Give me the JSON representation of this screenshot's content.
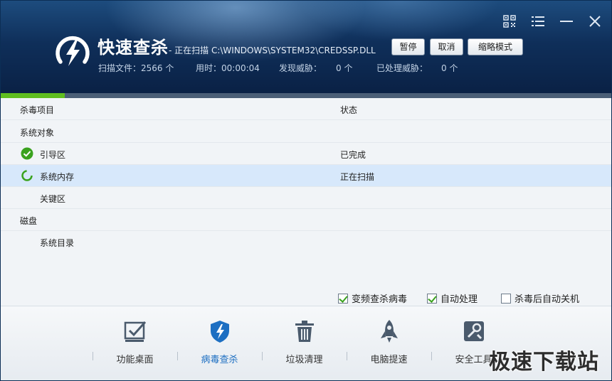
{
  "header": {
    "title": "快速查杀",
    "scan_path": "- 正在扫描 C:\\WINDOWS\\SYSTEM32\\CREDSSP.DLL",
    "stats": {
      "files": "扫描文件：2566 个",
      "time": "用时：00:00:04",
      "threats_label": "发现威胁：",
      "threats_value": "0 个",
      "handled_label": "已处理威胁：",
      "handled_value": "0 个"
    },
    "buttons": {
      "pause": "暂停",
      "cancel": "取消",
      "mini": "缩略模式"
    },
    "top_icons": [
      "qr-code-icon",
      "menu-icon",
      "minimize-icon",
      "close-icon"
    ]
  },
  "progress": {
    "fraction": 0.105,
    "color": "#5fbe1f"
  },
  "table": {
    "headers": {
      "item": "杀毒项目",
      "status": "状态"
    },
    "rows": [
      {
        "label": "系统对象",
        "status": "",
        "level": 0,
        "icon": ""
      },
      {
        "label": "引导区",
        "status": "已完成",
        "level": 1,
        "icon": "check-icon"
      },
      {
        "label": "系统内存",
        "status": "正在扫描",
        "level": 1,
        "icon": "spinner-icon"
      },
      {
        "label": "关键区",
        "status": "",
        "level": 1,
        "icon": ""
      },
      {
        "label": "磁盘",
        "status": "",
        "level": 0,
        "icon": ""
      },
      {
        "label": "系统目录",
        "status": "",
        "level": 1,
        "icon": ""
      }
    ]
  },
  "options": [
    {
      "label": "变频查杀病毒",
      "checked": true
    },
    {
      "label": "自动处理",
      "checked": true
    },
    {
      "label": "杀毒后自动关机",
      "checked": false
    }
  ],
  "nav": [
    {
      "label": "功能桌面",
      "icon": "desktop-check-icon",
      "active": false
    },
    {
      "label": "病毒查杀",
      "icon": "shield-icon",
      "active": true
    },
    {
      "label": "垃圾清理",
      "icon": "trash-icon",
      "active": false
    },
    {
      "label": "电脑提速",
      "icon": "rocket-icon",
      "active": false
    },
    {
      "label": "安全工具",
      "icon": "tools-icon",
      "active": false
    }
  ],
  "watermark": "极速下载站",
  "colors": {
    "accent": "#1d6fc2",
    "check": "#3aa21e",
    "header_dark": "#0f2f5a"
  }
}
